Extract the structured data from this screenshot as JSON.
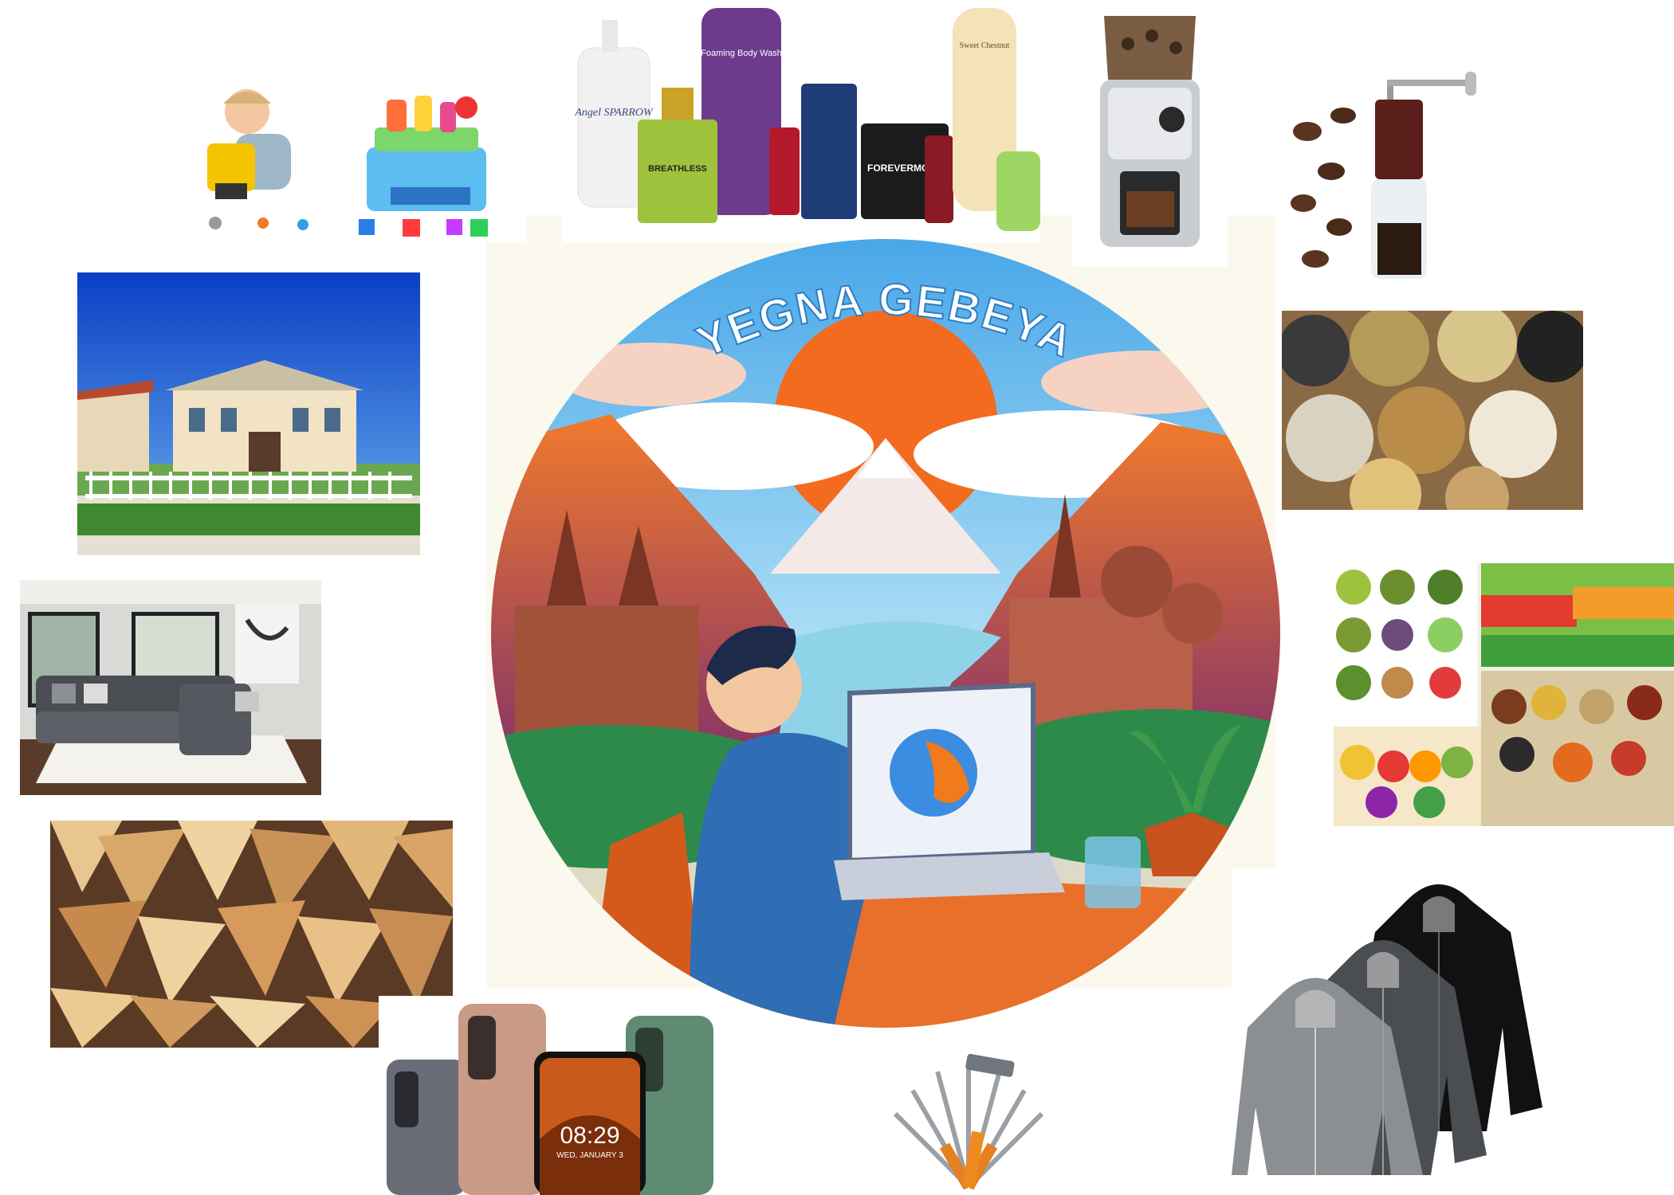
{
  "logo": {
    "title": "YEGNA GEBEYA"
  },
  "cosmetics": {
    "labels": [
      "Angel SPARROW",
      "Foaming Body Wash",
      "BREATHLESS",
      "FOREVERMORE",
      "Sweet Chestnut"
    ]
  },
  "phone": {
    "clock": "08:29",
    "date": "WED, JANUARY 3"
  },
  "colors": {
    "sky": "#6cc3f0",
    "sun": "#f26b1f",
    "mountain": "#e4612a",
    "shirt": "#2f6db5",
    "desk": "#e8702a",
    "water": "#8fd3e8"
  }
}
